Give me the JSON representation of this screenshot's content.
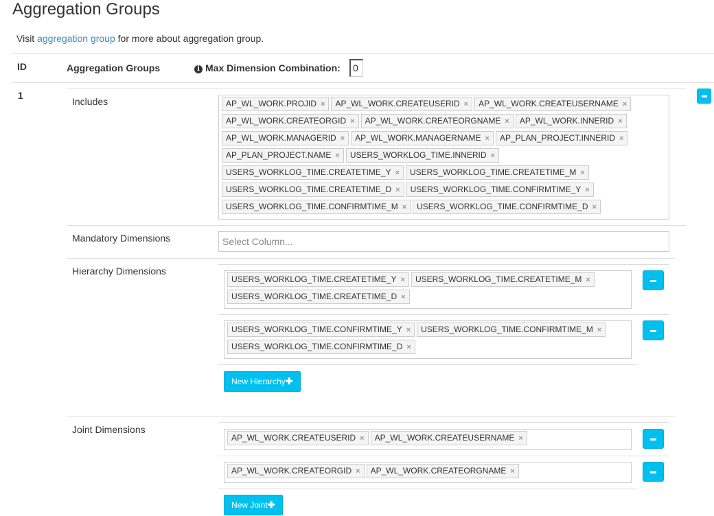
{
  "page": {
    "title": "Aggregation Groups",
    "intro_prefix": "Visit ",
    "intro_link": "aggregation group",
    "intro_suffix": " for more about aggregation group."
  },
  "table": {
    "col_id": "ID",
    "col_groups": "Aggregation Groups",
    "col_max": "Max Dimension Combination:",
    "max_value": "0"
  },
  "group": {
    "id": "1",
    "includes_label": "Includes",
    "includes": [
      "AP_WL_WORK.PROJID",
      "AP_WL_WORK.CREATEUSERID",
      "AP_WL_WORK.CREATEUSERNAME",
      "AP_WL_WORK.CREATEORGID",
      "AP_WL_WORK.CREATEORGNAME",
      "AP_WL_WORK.INNERID",
      "AP_WL_WORK.MANAGERID",
      "AP_WL_WORK.MANAGERNAME",
      "AP_PLAN_PROJECT.INNERID",
      "AP_PLAN_PROJECT.NAME",
      "USERS_WORKLOG_TIME.INNERID",
      "USERS_WORKLOG_TIME.CREATETIME_Y",
      "USERS_WORKLOG_TIME.CREATETIME_M",
      "USERS_WORKLOG_TIME.CREATETIME_D",
      "USERS_WORKLOG_TIME.CONFIRMTIME_Y",
      "USERS_WORKLOG_TIME.CONFIRMTIME_M",
      "USERS_WORKLOG_TIME.CONFIRMTIME_D"
    ],
    "mandatory_label": "Mandatory Dimensions",
    "mandatory_placeholder": "Select Column...",
    "hierarchy_label": "Hierarchy Dimensions",
    "hierarchies": [
      [
        "USERS_WORKLOG_TIME.CREATETIME_Y",
        "USERS_WORKLOG_TIME.CREATETIME_M",
        "USERS_WORKLOG_TIME.CREATETIME_D"
      ],
      [
        "USERS_WORKLOG_TIME.CONFIRMTIME_Y",
        "USERS_WORKLOG_TIME.CONFIRMTIME_M",
        "USERS_WORKLOG_TIME.CONFIRMTIME_D"
      ]
    ],
    "new_hierarchy_label": "New Hierarchy",
    "joint_label": "Joint Dimensions",
    "joints": [
      [
        "AP_WL_WORK.CREATEUSERID",
        "AP_WL_WORK.CREATEUSERNAME"
      ],
      [
        "AP_WL_WORK.CREATEORGID",
        "AP_WL_WORK.CREATEORGNAME"
      ]
    ],
    "new_joint_label": "New Joint"
  },
  "icons": {
    "remove": "minus-icon",
    "tag_remove": "×",
    "add": "plus-icon",
    "info": "info-circle-icon"
  },
  "colors": {
    "accent": "#00c0ef",
    "link": "#3c8dbc"
  }
}
